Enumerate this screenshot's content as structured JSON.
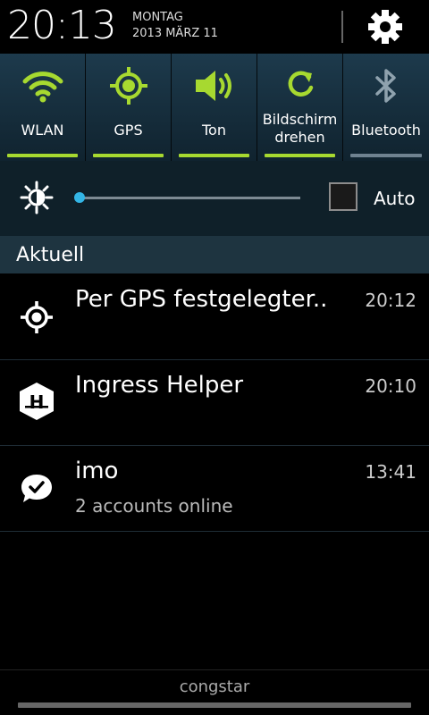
{
  "status": {
    "time": "20:13",
    "weekday": "MONTAG",
    "date": "2013 MÄRZ 11"
  },
  "icons": {
    "settings": "gear-icon",
    "wlan": "wifi-icon",
    "gps": "gps-target-icon",
    "sound": "speaker-icon",
    "rotate": "rotate-icon",
    "bluetooth": "bluetooth-icon",
    "brightness": "brightness-icon"
  },
  "toggles": [
    {
      "label": "WLAN",
      "active": true
    },
    {
      "label": "GPS",
      "active": true
    },
    {
      "label": "Ton",
      "active": true
    },
    {
      "label": "Bildschirm drehen",
      "active": true
    },
    {
      "label": "Bluetooth",
      "active": false
    }
  ],
  "brightness": {
    "auto_label": "Auto",
    "auto_checked": false,
    "level": 0.0
  },
  "section_title": "Aktuell",
  "notifications": [
    {
      "title": "Per GPS festgelegter..",
      "subtitle": "",
      "time": "20:12",
      "icon": "gps-target-icon"
    },
    {
      "title": "Ingress Helper",
      "subtitle": "",
      "time": "20:10",
      "icon": "ingress-hexagon-icon"
    },
    {
      "title": "imo",
      "subtitle": "2 accounts online",
      "time": "13:41",
      "icon": "imo-chat-bubble-icon"
    }
  ],
  "carrier": "congstar",
  "colors": {
    "active_bar": "#a7d930",
    "inactive_bar": "#6f8290",
    "accent": "#33b5e5"
  }
}
